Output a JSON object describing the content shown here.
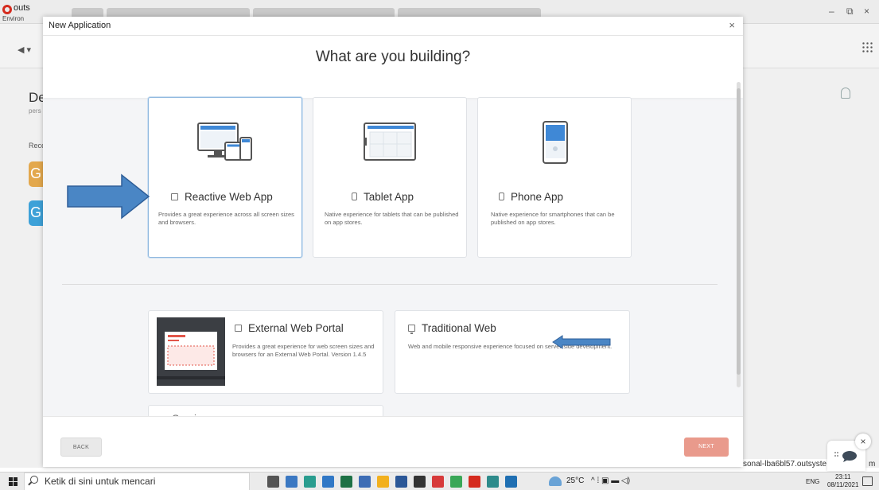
{
  "app": {
    "title": "outs",
    "env_label": "Environ",
    "back_icon": "◀ ▾",
    "window_controls": [
      "–",
      "⧉",
      "×"
    ],
    "left_title": "De",
    "left_sub": "pers",
    "recent_label": "Rece",
    "tiles": [
      {
        "letter": "G",
        "color": "#e3a84d"
      },
      {
        "letter": "G",
        "color": "#3da1d8"
      }
    ],
    "url_text": "sonal-lba6bl57.outsyste",
    "url_suffix": "m"
  },
  "modal": {
    "title": "New Application",
    "close_icon": "×",
    "question": "What are you building?",
    "cards": [
      {
        "title": "Reactive Web App",
        "icon": "responsive-icon",
        "description": "Provides a great experience across all screen sizes and browsers.",
        "selected": true
      },
      {
        "title": "Tablet App",
        "icon": "tablet-icon",
        "description": "Native experience for tablets that can be published on app stores.",
        "selected": false
      },
      {
        "title": "Phone App",
        "icon": "phone-icon",
        "description": "Native experience for smartphones that can be published on app stores.",
        "selected": false
      }
    ],
    "other_cards": [
      {
        "title": "External Web Portal",
        "icon": "responsive-icon",
        "description": "Provides a great experience for web screen sizes and browsers for an External Web Portal. Version 1.4.5"
      },
      {
        "title": "Traditional Web",
        "icon": "monitor-icon",
        "description": "Web and mobile responsive experience focused on server-side development."
      },
      {
        "title": "Service",
        "icon": "service-icon",
        "description": ""
      }
    ],
    "back_label": "BACK",
    "next_label": "NEXT"
  },
  "annotations": {
    "arrow_color": "#4a86c5",
    "arrow_stroke": "#2f5f99"
  },
  "chat": {
    "close_icon": "×"
  },
  "taskbar": {
    "search_placeholder": "Ketik di sini untuk mencari",
    "weather": "25°C",
    "tray_symbols": "^ ⁞ ▣ ▬ ◁)",
    "language": "ENG",
    "time": "23:11",
    "date": "08/11/2021",
    "app_icons": [
      {
        "name": "task-view-icon",
        "color": "#555555"
      },
      {
        "name": "file-explorer-icon",
        "color": "#3b78c2"
      },
      {
        "name": "edge-icon",
        "color": "#2a9d8f"
      },
      {
        "name": "mail-icon",
        "color": "#3178c6"
      },
      {
        "name": "excel-icon",
        "color": "#1e7145"
      },
      {
        "name": "app-b-icon",
        "color": "#3e6db5"
      },
      {
        "name": "folder-icon",
        "color": "#f2b01e"
      },
      {
        "name": "store-icon",
        "color": "#2b5797"
      },
      {
        "name": "calculator-icon",
        "color": "#333333"
      },
      {
        "name": "wps-icon",
        "color": "#d73a3a"
      },
      {
        "name": "chrome-icon",
        "color": "#3aa757"
      },
      {
        "name": "outsystems-icon",
        "color": "#d52b1e"
      },
      {
        "name": "edge-dev-icon",
        "color": "#2e8b8b"
      },
      {
        "name": "media-icon",
        "color": "#1f6fb2"
      }
    ]
  }
}
